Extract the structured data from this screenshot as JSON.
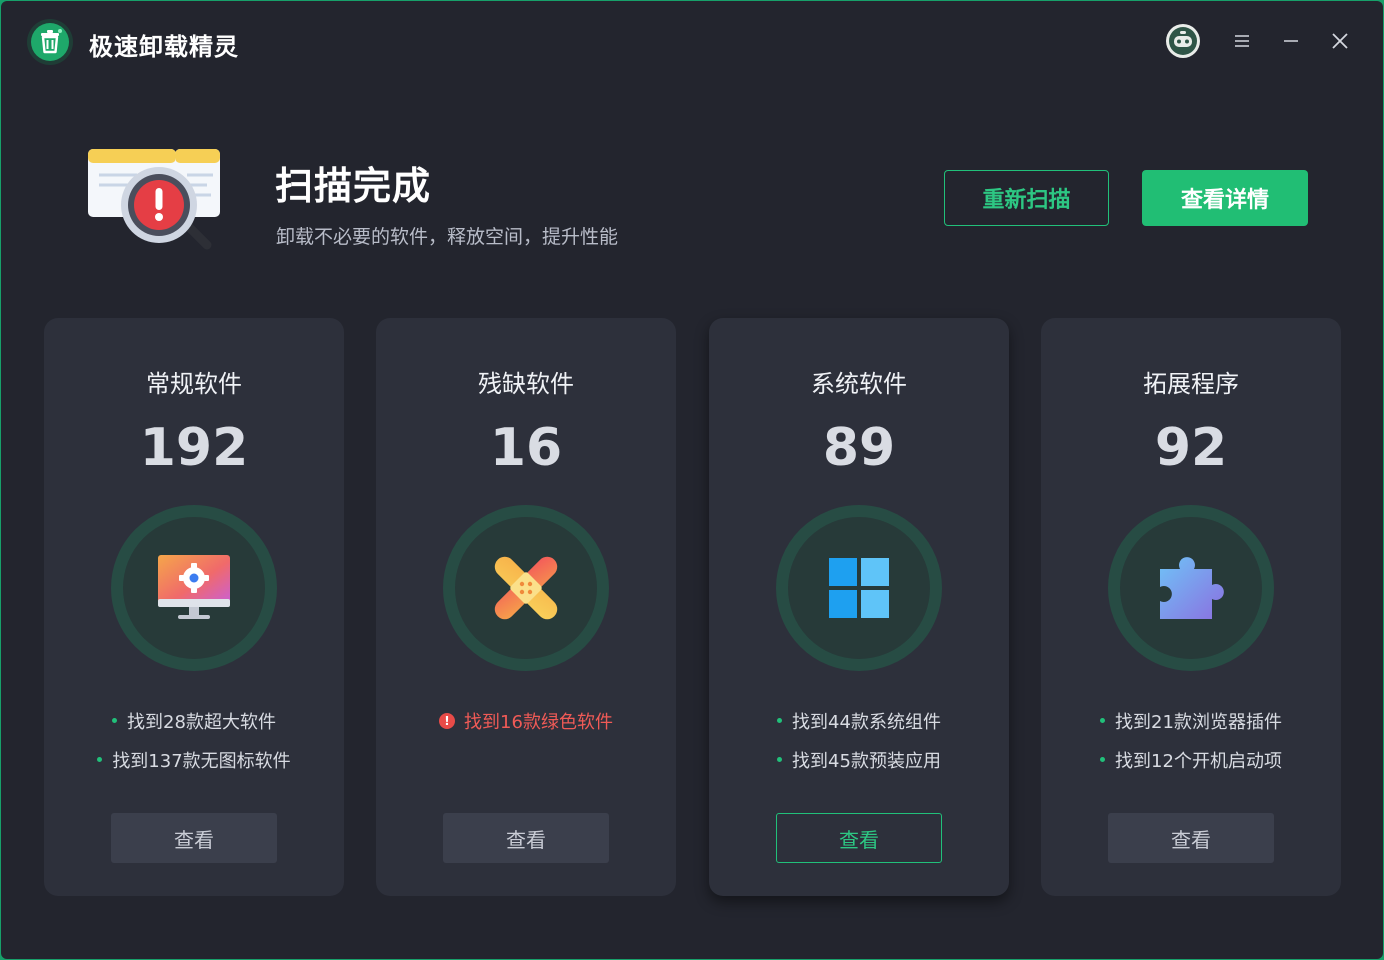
{
  "app": {
    "title": "极速卸载精灵",
    "accent_color": "#21be74",
    "icons": {
      "logo": "trash-bin-icon",
      "avatar": "robot-avatar-icon",
      "menu": "hamburger-menu-icon",
      "minimize": "minimize-icon",
      "close": "close-icon"
    }
  },
  "header": {
    "title": "扫描完成",
    "subtitle": "卸载不必要的软件，释放空间，提升性能",
    "icon": "scan-alert-magnifier-icon",
    "rescan_label": "重新扫描",
    "detail_label": "查看详情"
  },
  "cards": [
    {
      "title": "常规软件",
      "count": "192",
      "icon": "monitor-gear-icon",
      "finds": [
        "找到28款超大软件",
        "找到137款无图标软件"
      ],
      "view_label": "查看"
    },
    {
      "title": "残缺软件",
      "count": "16",
      "icon": "bandage-icon",
      "finds": [
        "找到16款绿色软件"
      ],
      "warning": true,
      "view_label": "查看"
    },
    {
      "title": "系统软件",
      "count": "89",
      "icon": "windows-icon",
      "finds": [
        "找到44款系统组件",
        "找到45款预装应用"
      ],
      "view_label": "查看",
      "active": true
    },
    {
      "title": "拓展程序",
      "count": "92",
      "icon": "puzzle-icon",
      "finds": [
        "找到21款浏览器插件",
        "找到12个开机启动项"
      ],
      "view_label": "查看"
    }
  ]
}
